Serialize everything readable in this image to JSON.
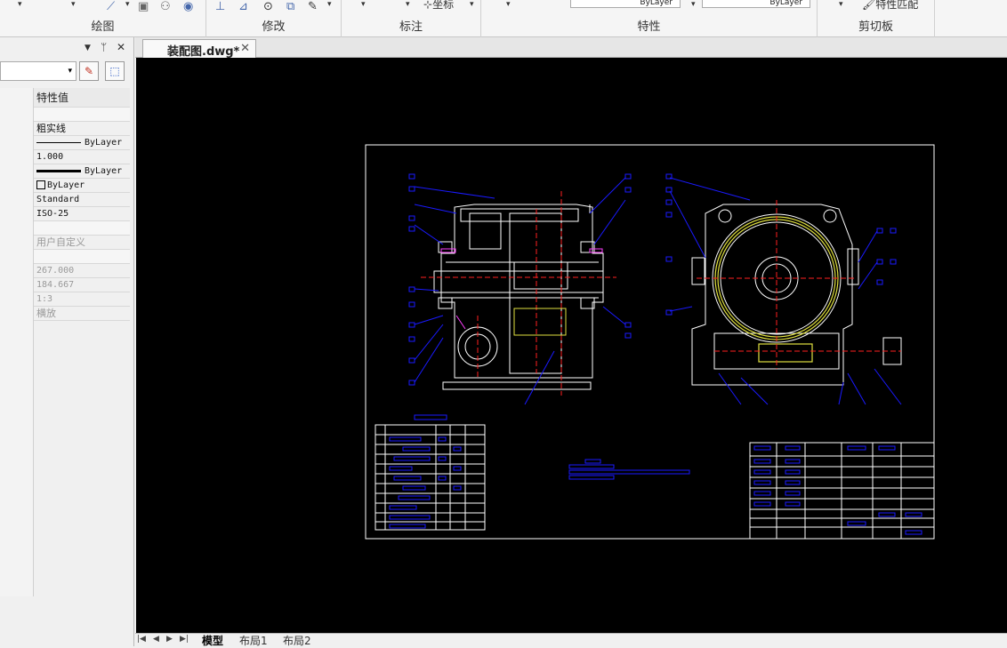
{
  "ribbon": {
    "groups": [
      {
        "label": "绘图"
      },
      {
        "label": "修改"
      },
      {
        "label": "标注"
      },
      {
        "label": "特性"
      },
      {
        "label": "剪切板"
      }
    ],
    "coordinate_button": "坐标",
    "layer_combo_1": "ByLayer",
    "layer_combo_2": "ByLayer",
    "match_properties": "特性匹配"
  },
  "properties_panel": {
    "header_value": "特性值",
    "rows": [
      {
        "value": "粗实线"
      },
      {
        "value": "ByLayer"
      },
      {
        "value": "1.000"
      },
      {
        "value": "ByLayer"
      },
      {
        "value": "ByLayer"
      },
      {
        "value": "Standard"
      },
      {
        "value": "ISO-25"
      },
      {
        "value": ""
      },
      {
        "value": "用户自定义"
      },
      {
        "value": ""
      },
      {
        "value": "267.000"
      },
      {
        "value": "184.667"
      },
      {
        "value": "1:3"
      },
      {
        "value": "横放"
      }
    ]
  },
  "document": {
    "tab_title": "装配图.dwg*"
  },
  "layout_tabs": [
    {
      "label": "模型",
      "active": true
    },
    {
      "label": "布局1",
      "active": false
    },
    {
      "label": "布局2",
      "active": false
    }
  ],
  "colors": {
    "canvas": "#000000",
    "frame": "#ffffff",
    "annotation": "#1a1aff",
    "centerline": "#ff2020",
    "highlight": "#e0e040"
  }
}
